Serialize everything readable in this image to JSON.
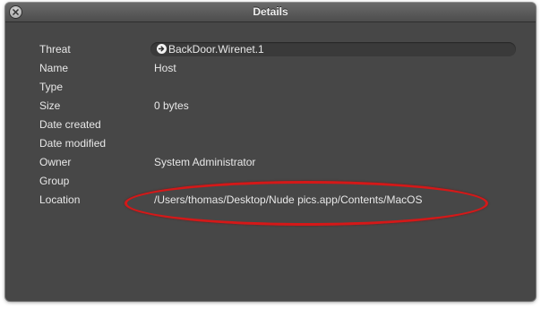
{
  "window": {
    "title": "Details",
    "close_icon": "close-icon"
  },
  "fields": [
    {
      "key": "threat",
      "label": "Threat",
      "value": "BackDoor.Wirenet.1"
    },
    {
      "key": "name",
      "label": "Name",
      "value": "Host"
    },
    {
      "key": "type",
      "label": "Type",
      "value": ""
    },
    {
      "key": "size",
      "label": "Size",
      "value": "0 bytes"
    },
    {
      "key": "date_created",
      "label": "Date created",
      "value": ""
    },
    {
      "key": "date_modified",
      "label": "Date modified",
      "value": ""
    },
    {
      "key": "owner",
      "label": "Owner",
      "value": "System Administrator"
    },
    {
      "key": "group",
      "label": "Group",
      "value": ""
    },
    {
      "key": "location",
      "label": "Location",
      "value": "/Users/thomas/Desktop/Nude pics.app/Contents/MacOS"
    }
  ],
  "threat_link_icon": "arrow-right-circle-icon",
  "colors": {
    "window_bg": "#474747",
    "text": "#e8e8e8",
    "annotation_red": "#d51818"
  }
}
